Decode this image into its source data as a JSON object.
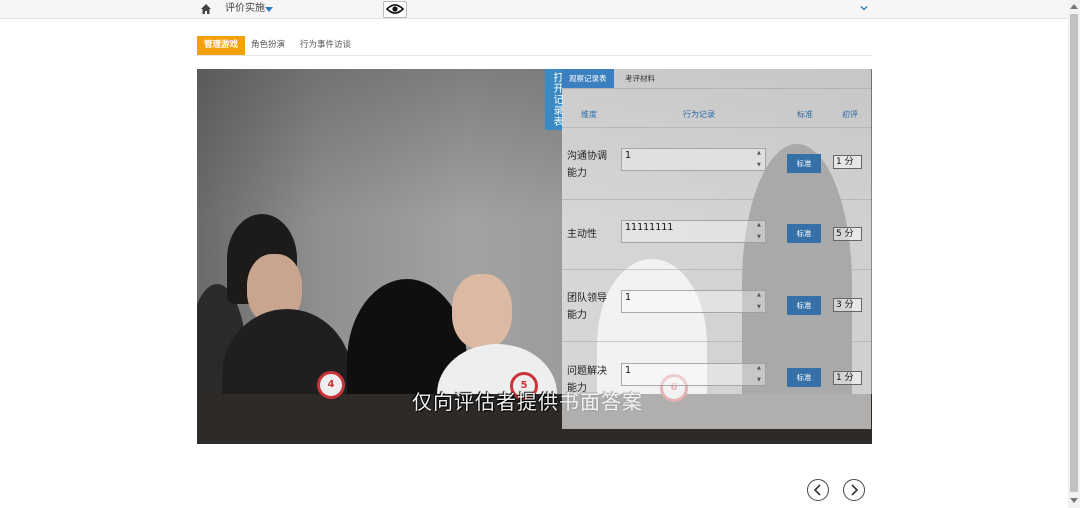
{
  "header": {
    "nav_title": "评价实施",
    "icons": [
      "home-icon",
      "caret-down-icon",
      "eye-icon",
      "chevron-down-icon"
    ]
  },
  "tabs": [
    {
      "label": "管理游戏",
      "active": true
    },
    {
      "label": "角色扮演",
      "active": false
    },
    {
      "label": "行为事件访谈",
      "active": false
    }
  ],
  "video": {
    "subtitle": "仅向评估者提供书面答案",
    "badges": [
      "4",
      "5",
      "6"
    ]
  },
  "record_panel": {
    "open_tab_label": "打开记录表",
    "tabs": [
      {
        "label": "观察记录表",
        "active": true
      },
      {
        "label": "考评材料",
        "active": false
      }
    ],
    "columns": {
      "dimension": "维度",
      "record": "行为记录",
      "standard": "标准",
      "score": "初评"
    },
    "rows": [
      {
        "dimension": "沟通协调能力",
        "record": "1",
        "standard_label": "标准",
        "score": "1 分"
      },
      {
        "dimension": "主动性",
        "record": "11111111",
        "standard_label": "标准",
        "score": "5 分"
      },
      {
        "dimension": "团队领导能力",
        "record": "1",
        "standard_label": "标准",
        "score": "3 分"
      },
      {
        "dimension": "问题解决能力",
        "record": "1",
        "standard_label": "标准",
        "score": "1 分"
      }
    ]
  },
  "pager": {
    "prev_icon": "chevron-left-icon",
    "next_icon": "chevron-right-icon"
  },
  "colors": {
    "accent_orange": "#f5a10f",
    "primary_blue": "#3a7fbf",
    "button_blue": "#3570a8"
  }
}
